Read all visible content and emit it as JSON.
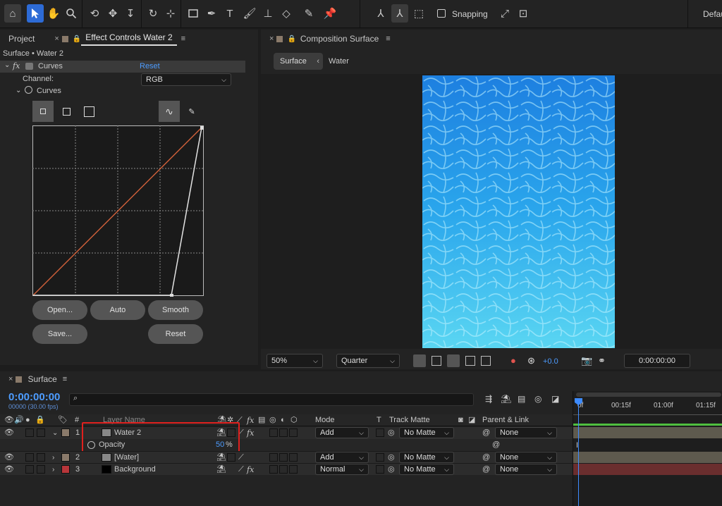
{
  "toolbar": {
    "snapping_label": "Snapping",
    "workspace_label": "Defau"
  },
  "left_panel": {
    "tab_project": "Project",
    "tab_effect_controls": "Effect Controls Water 2",
    "breadcrumb": "Surface • Water 2",
    "effect_name": "Curves",
    "effect_reset": "Reset",
    "channel_label": "Channel:",
    "channel_value": "RGB",
    "curves_prop": "Curves",
    "buttons": {
      "open": "Open...",
      "auto": "Auto",
      "smooth": "Smooth",
      "save": "Save...",
      "reset": "Reset"
    }
  },
  "comp_panel": {
    "tab_title": "Composition Surface",
    "crumb_surface": "Surface",
    "crumb_water": "Water",
    "zoom": "50%",
    "resolution": "Quarter",
    "exposure": "+0.0",
    "timecode": "0:00:00:00"
  },
  "timeline": {
    "tab_title": "Surface",
    "timecode": "0:00:00:00",
    "frame_info": "00000 (30.00 fps)",
    "columns": {
      "num": "#",
      "layer_name": "Layer Name",
      "mode": "Mode",
      "t": "T",
      "track_matte": "Track Matte",
      "parent_link": "Parent & Link"
    },
    "ruler": [
      "0f",
      "00:15f",
      "01:00f",
      "01:15f"
    ],
    "layers": [
      {
        "num": "1",
        "name": "Water 2",
        "mode": "Add",
        "matte": "No Matte",
        "parent": "None"
      },
      {
        "num": "2",
        "name": "[Water]",
        "mode": "Add",
        "matte": "No Matte",
        "parent": "None"
      },
      {
        "num": "3",
        "name": "Background",
        "mode": "Normal",
        "matte": "No Matte",
        "parent": "None"
      }
    ],
    "opacity_label": "Opacity",
    "opacity_value": "50",
    "opacity_unit": "%"
  },
  "colors": {
    "accent_blue": "#2d6bd6",
    "timecode_blue": "#4d9cff",
    "highlight_red": "#e0201e",
    "curve_orange": "#d2613b",
    "water_light": "#5ad6f2",
    "water_deep": "#1d7fe0",
    "bar_green": "#4fbf3f",
    "bar_tan": "#5e5a4e",
    "bar_red": "#6a2e2e"
  }
}
